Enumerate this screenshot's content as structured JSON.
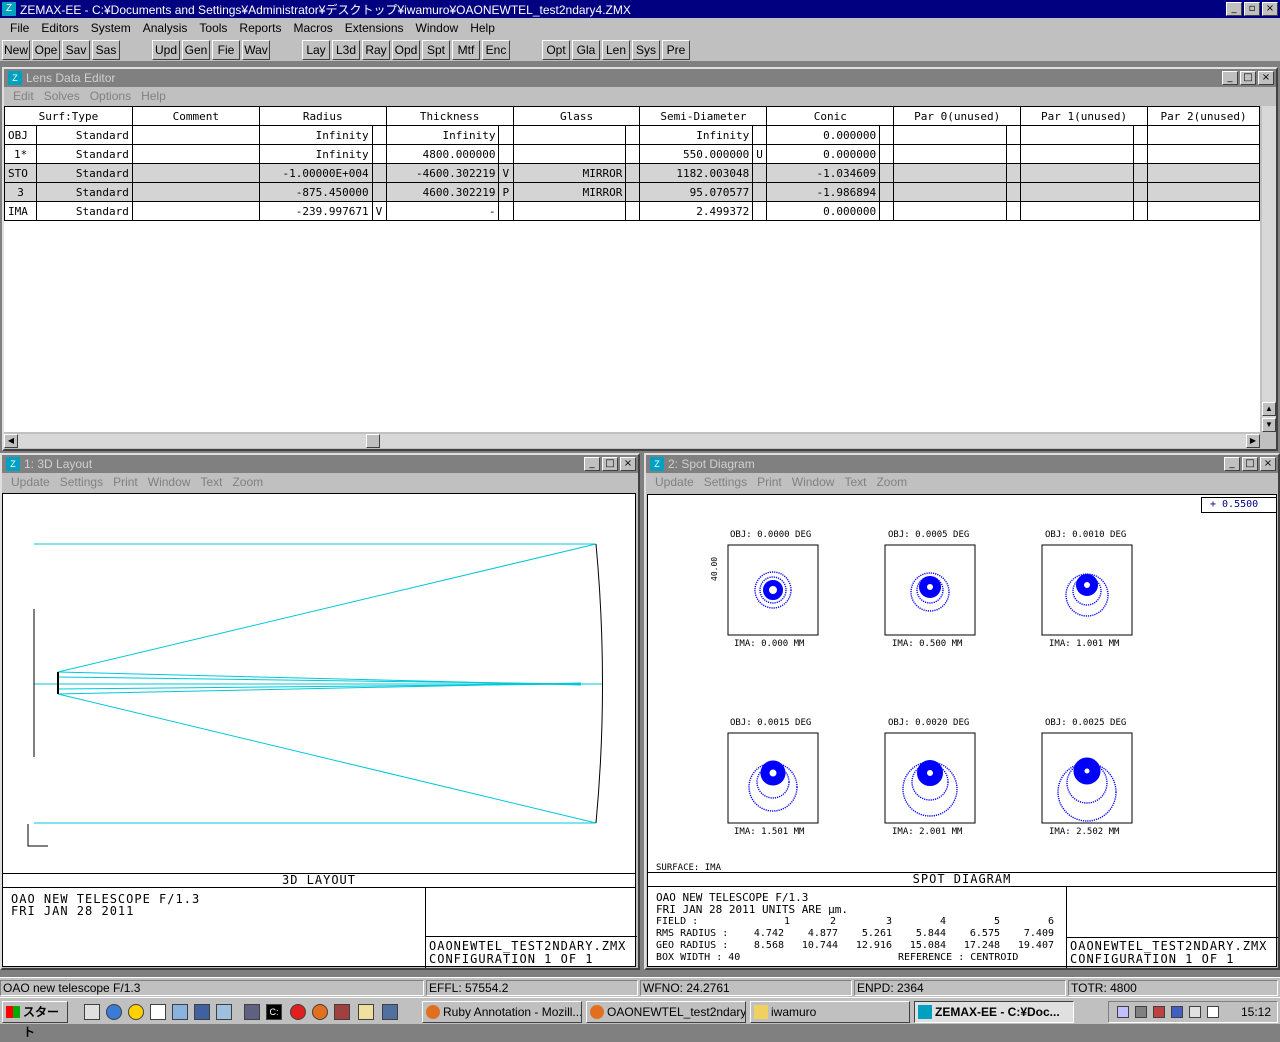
{
  "app": {
    "title": "ZEMAX-EE - C:¥Documents and Settings¥Administrator¥デスクトップ¥iwamuro¥OAONEWTEL_test2ndary4.ZMX",
    "icon_label": "Z"
  },
  "menu": [
    "File",
    "Editors",
    "System",
    "Analysis",
    "Tools",
    "Reports",
    "Macros",
    "Extensions",
    "Window",
    "Help"
  ],
  "toolbar": {
    "group1": [
      "New",
      "Ope",
      "Sav",
      "Sas"
    ],
    "group2": [
      "Upd",
      "Gen",
      "Fie",
      "Wav"
    ],
    "group3": [
      "Lay",
      "L3d",
      "Ray",
      "Opd",
      "Spt",
      "Mtf",
      "Enc"
    ],
    "group4": [
      "Opt",
      "Gla",
      "Len",
      "Sys",
      "Pre"
    ]
  },
  "lens_editor": {
    "title": "Lens Data Editor",
    "menu": [
      "Edit",
      "Solves",
      "Options",
      "Help"
    ],
    "headers": [
      "Surf:Type",
      "Comment",
      "Radius",
      "Thickness",
      "Glass",
      "Semi-Diameter",
      "Conic",
      "Par 0(unused)",
      "Par 1(unused)",
      "Par 2(unused)"
    ],
    "rows": [
      {
        "surf": "OBJ",
        "type": "Standard",
        "comment": "",
        "radius": "Infinity",
        "rs": "",
        "thickness": "Infinity",
        "ts": "",
        "glass": "",
        "gs": "",
        "semi": "Infinity",
        "ss": "",
        "conic": "0.000000"
      },
      {
        "surf": "1*",
        "type": "Standard",
        "comment": "",
        "radius": "Infinity",
        "rs": "",
        "thickness": "4800.000000",
        "ts": "",
        "glass": "",
        "gs": "",
        "semi": "550.000000",
        "ss": "U",
        "conic": "0.000000"
      },
      {
        "surf": "STO",
        "type": "Standard",
        "comment": "",
        "radius": "-1.00000E+004",
        "rs": "",
        "thickness": "-4600.302219",
        "ts": "V",
        "glass": "MIRROR",
        "gs": "",
        "semi": "1182.003048",
        "ss": "",
        "conic": "-1.034609"
      },
      {
        "surf": "3",
        "type": "Standard",
        "comment": "",
        "radius": "-875.450000",
        "rs": "",
        "thickness": "4600.302219",
        "ts": "P",
        "glass": "MIRROR",
        "gs": "",
        "semi": "95.070577",
        "ss": "",
        "conic": "-1.986894"
      },
      {
        "surf": "IMA",
        "type": "Standard",
        "comment": "",
        "radius": "-239.997671",
        "rs": "V",
        "thickness": "-",
        "ts": "",
        "glass": "",
        "gs": "",
        "semi": "2.499372",
        "ss": "",
        "conic": "0.000000"
      }
    ]
  },
  "layout_window": {
    "title": "1: 3D Layout",
    "menu": [
      "Update",
      "Settings",
      "Print",
      "Window",
      "Text",
      "Zoom"
    ],
    "plot_label": "3D LAYOUT",
    "info_line1": "OAO NEW TELESCOPE F/1.3",
    "info_line2": "FRI JAN 28 2011",
    "file_line": "OAONEWTEL_TEST2NDARY.ZMX",
    "config_line": "CONFIGURATION  1  OF  1"
  },
  "spot_window": {
    "title": "2: Spot Diagram",
    "menu": [
      "Update",
      "Settings",
      "Print",
      "Window",
      "Text",
      "Zoom"
    ],
    "wavelength": "+  0.5500",
    "scale_label": "40.00",
    "surface_label": "SURFACE: IMA",
    "plot_label": "SPOT DIAGRAM",
    "fields": [
      {
        "obj": "OBJ: 0.0000 DEG",
        "ima": "IMA: 0.000 MM"
      },
      {
        "obj": "OBJ: 0.0005 DEG",
        "ima": "IMA: 0.500 MM"
      },
      {
        "obj": "OBJ: 0.0010 DEG",
        "ima": "IMA: 1.001 MM"
      },
      {
        "obj": "OBJ: 0.0015 DEG",
        "ima": "IMA: 1.501 MM"
      },
      {
        "obj": "OBJ: 0.0020 DEG",
        "ima": "IMA: 2.001 MM"
      },
      {
        "obj": "OBJ: 0.0025 DEG",
        "ima": "IMA: 2.502 MM"
      }
    ],
    "info_line1": "OAO NEW TELESCOPE F/1.3",
    "info_line2": "FRI JAN 28 2011   UNITS ARE µm.",
    "field_label": "FIELD      :",
    "field_values": [
      "1",
      "2",
      "3",
      "4",
      "5",
      "6"
    ],
    "rms_label": "RMS RADIUS :",
    "rms_values": [
      "4.742",
      "4.877",
      "5.261",
      "5.844",
      "6.575",
      "7.409"
    ],
    "geo_label": "GEO RADIUS :",
    "geo_values": [
      "8.568",
      "10.744",
      "12.916",
      "15.084",
      "17.248",
      "19.407"
    ],
    "box_line": "BOX WIDTH  :        40",
    "reference_line": "REFERENCE  : CENTROID",
    "file_line": "OAONEWTEL_TEST2NDARY.ZMX",
    "config_line": "CONFIGURATION  1  OF  1"
  },
  "status": {
    "title": "OAO new telescope F/1.3",
    "effl": "EFFL: 57554.2",
    "wfno": "WFNO: 24.2761",
    "enpd": "ENPD: 2364",
    "totr": "TOTR: 4800"
  },
  "taskbar": {
    "start": "スタート",
    "tasks": [
      "Ruby Annotation - Mozill...",
      "OAONEWTEL_test2ndary...",
      "iwamuro",
      "ZEMAX-EE - C:¥Doc..."
    ],
    "clock": "15:12"
  },
  "colors": {
    "titlebar": "#000080",
    "ray": "#00c8d8",
    "spot": "#0000ff"
  }
}
